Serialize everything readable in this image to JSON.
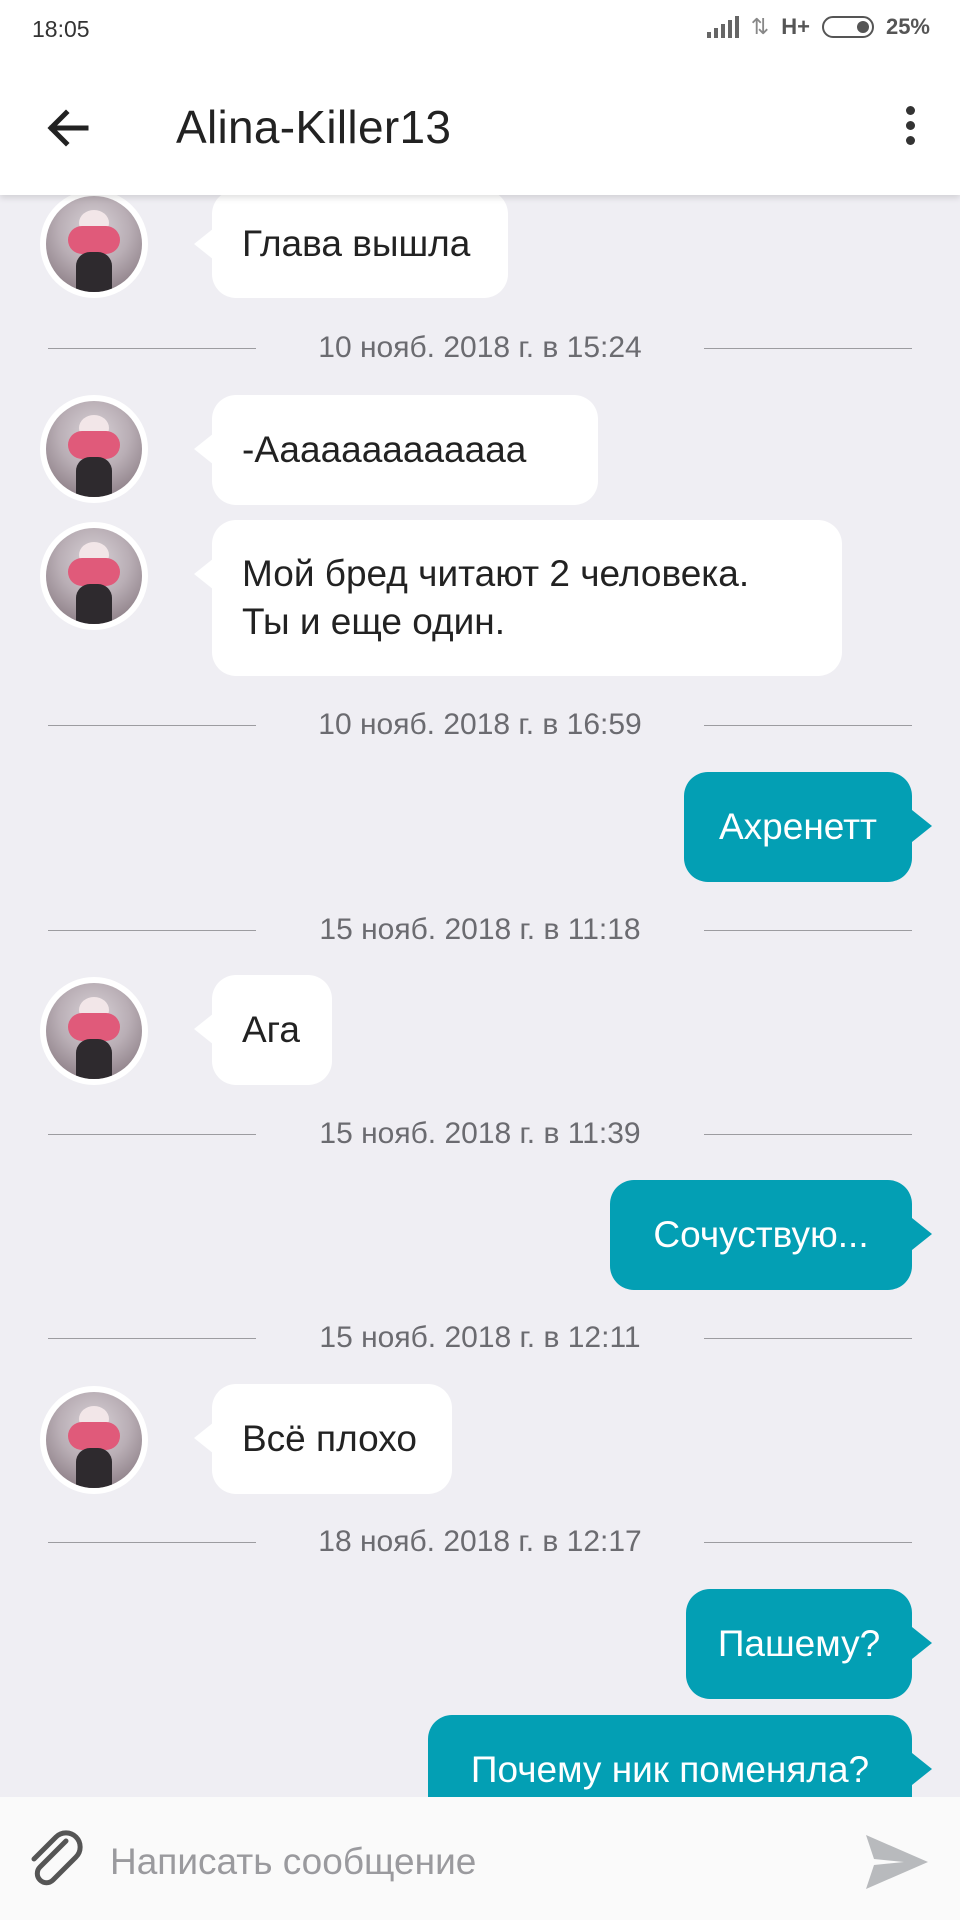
{
  "status_bar": {
    "time": "18:05",
    "network": "H+",
    "battery": "25%"
  },
  "header": {
    "title": "Alina-Killer13"
  },
  "messages": [
    {
      "type": "in",
      "text": "Глава вышла"
    },
    {
      "type": "divider",
      "text": "10 нояб. 2018 г. в 15:24"
    },
    {
      "type": "in",
      "text": "-Ааааааааааааа"
    },
    {
      "type": "in",
      "text": "Мой бред читают 2 человека.\nТы и еще один."
    },
    {
      "type": "divider",
      "text": "10 нояб. 2018 г. в 16:59"
    },
    {
      "type": "out",
      "text": "Ахренетт"
    },
    {
      "type": "divider",
      "text": "15 нояб. 2018 г. в 11:18"
    },
    {
      "type": "in",
      "text": "Ага"
    },
    {
      "type": "divider",
      "text": "15 нояб. 2018 г. в 11:39"
    },
    {
      "type": "out",
      "text": "Сочуствую..."
    },
    {
      "type": "divider",
      "text": "15 нояб. 2018 г. в 12:11"
    },
    {
      "type": "in",
      "text": "Всё плохо"
    },
    {
      "type": "divider",
      "text": "18 нояб. 2018 г. в 12:17"
    },
    {
      "type": "out",
      "text": "Пашему?"
    },
    {
      "type": "out",
      "text": "Почему ник поменяла?"
    }
  ],
  "composer": {
    "placeholder": "Написать сообщение",
    "value": ""
  },
  "icons": {
    "back": "arrow-left-icon",
    "menu": "more-vert-icon",
    "attach": "paperclip-icon",
    "send": "send-icon"
  },
  "colors": {
    "outgoing_bubble": "#039fb4",
    "incoming_bubble": "#ffffff",
    "background": "#efeef3"
  }
}
